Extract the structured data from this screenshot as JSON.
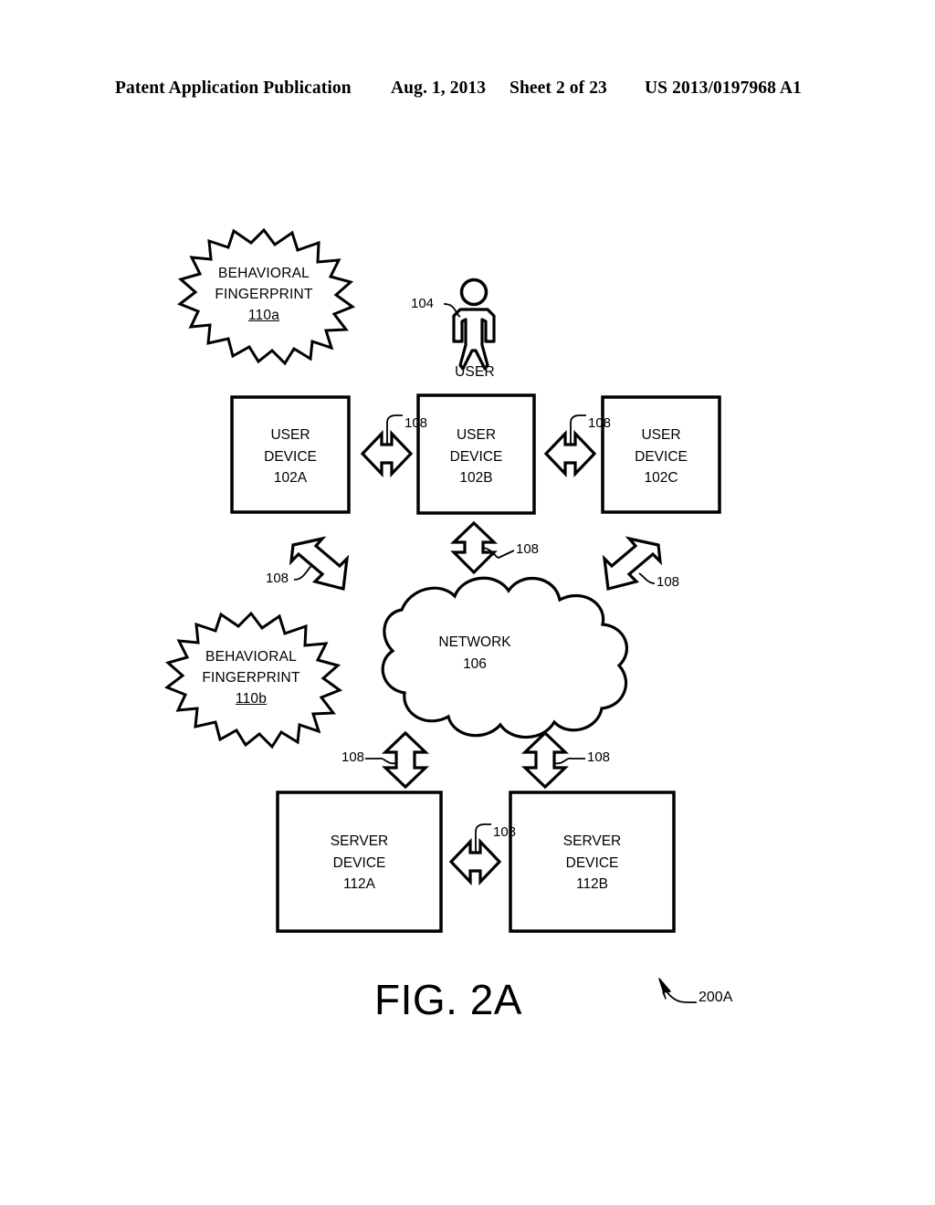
{
  "header": {
    "publication": "Patent Application Publication",
    "date": "Aug. 1, 2013",
    "sheet": "Sheet 2 of 23",
    "patent_number": "US 2013/0197968 A1"
  },
  "figure": {
    "caption": "FIG. 2A",
    "figure_ref": "200A",
    "user_actor": {
      "label": "USER",
      "ref": "104"
    },
    "behavioral_fingerprints": [
      {
        "line1": "BEHAVIORAL",
        "line2": "FINGERPRINT",
        "ref": "110a"
      },
      {
        "line1": "BEHAVIORAL",
        "line2": "FINGERPRINT",
        "ref": "110b"
      }
    ],
    "user_devices": [
      {
        "line1": "USER",
        "line2": "DEVICE",
        "ref": "102A"
      },
      {
        "line1": "USER",
        "line2": "DEVICE",
        "ref": "102B"
      },
      {
        "line1": "USER",
        "line2": "DEVICE",
        "ref": "102C"
      }
    ],
    "network": {
      "label": "NETWORK",
      "ref": "106"
    },
    "server_devices": [
      {
        "line1": "SERVER",
        "line2": "DEVICE",
        "ref": "112A"
      },
      {
        "line1": "SERVER",
        "line2": "DEVICE",
        "ref": "112B"
      }
    ],
    "link_ref": "108",
    "links": [
      {
        "id": "link-102a-102b",
        "ref": "108"
      },
      {
        "id": "link-102b-102c",
        "ref": "108"
      },
      {
        "id": "link-102a-network",
        "ref": "108"
      },
      {
        "id": "link-102b-network",
        "ref": "108"
      },
      {
        "id": "link-102c-network",
        "ref": "108"
      },
      {
        "id": "link-network-112a",
        "ref": "108"
      },
      {
        "id": "link-network-112b",
        "ref": "108"
      },
      {
        "id": "link-112a-112b",
        "ref": "108"
      }
    ]
  },
  "colors": {
    "ink": "#000000",
    "paper": "#ffffff"
  }
}
